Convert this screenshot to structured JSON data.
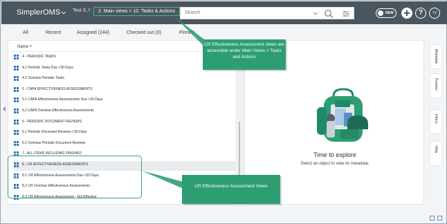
{
  "app": {
    "logo": "SimplerOMS",
    "breadcrumb": [
      "Test 3...",
      ">",
      "2. Main views > 10. Tasks & Actions"
    ]
  },
  "search": {
    "placeholder": "Search"
  },
  "header_controls": {
    "toggle_label": "NEW",
    "help_label": "?",
    "avatar_initials": "TZ"
  },
  "tabs": [
    {
      "label": "All"
    },
    {
      "label": "Recent"
    },
    {
      "label": "Assigned (244)"
    },
    {
      "label": "Checked out (0)"
    },
    {
      "label": "Pinned"
    }
  ],
  "list": {
    "column_header": "Name",
    "items": [
      "4 - PERIODIC TASKS",
      "4.1   Periodic Tasks Due <30 Days",
      "4.2   Overdue Periodic Tasks",
      "5 - CAPA EFFECTIVENESS ASSESSMENTS",
      "5.1   CAPA Effectiveness Assessments Due <30 Days",
      "5.2   CAPA Overdue Effectiveness Assessments",
      "6 - PERIODIC DOCUMENT REVIEWS",
      "6.1   Periodic Document Reviews <30 Days",
      "6.2   Overdue Periodic Document Reviews",
      "7 - ALL ITEMS INCLUDING FINISHED",
      "8 - CR EFFECTIVENESS ASSESSMENTS",
      "8.1   CR Effectiveness Assessments Due <30 Days",
      "8.2   CR Overdue Effectiveness Assessments",
      "8.3   CR Effectiveness Assessment - Not Effective"
    ]
  },
  "empty_state": {
    "title": "Time to explore",
    "subtitle": "Select an object to view its metadata."
  },
  "side_tabs": [
    "Metadata",
    "Preview",
    "Filters",
    "Help"
  ],
  "callouts": {
    "top": "CR Effectiveness Assessment views are accessible under Main Views > Tasks and Actions",
    "bottom": "CR Effectiveness Assessment Views"
  },
  "colors": {
    "topbar": "#4a565f",
    "accent_green": "#2e9e72",
    "icon_blue": "#2f6fc6"
  }
}
